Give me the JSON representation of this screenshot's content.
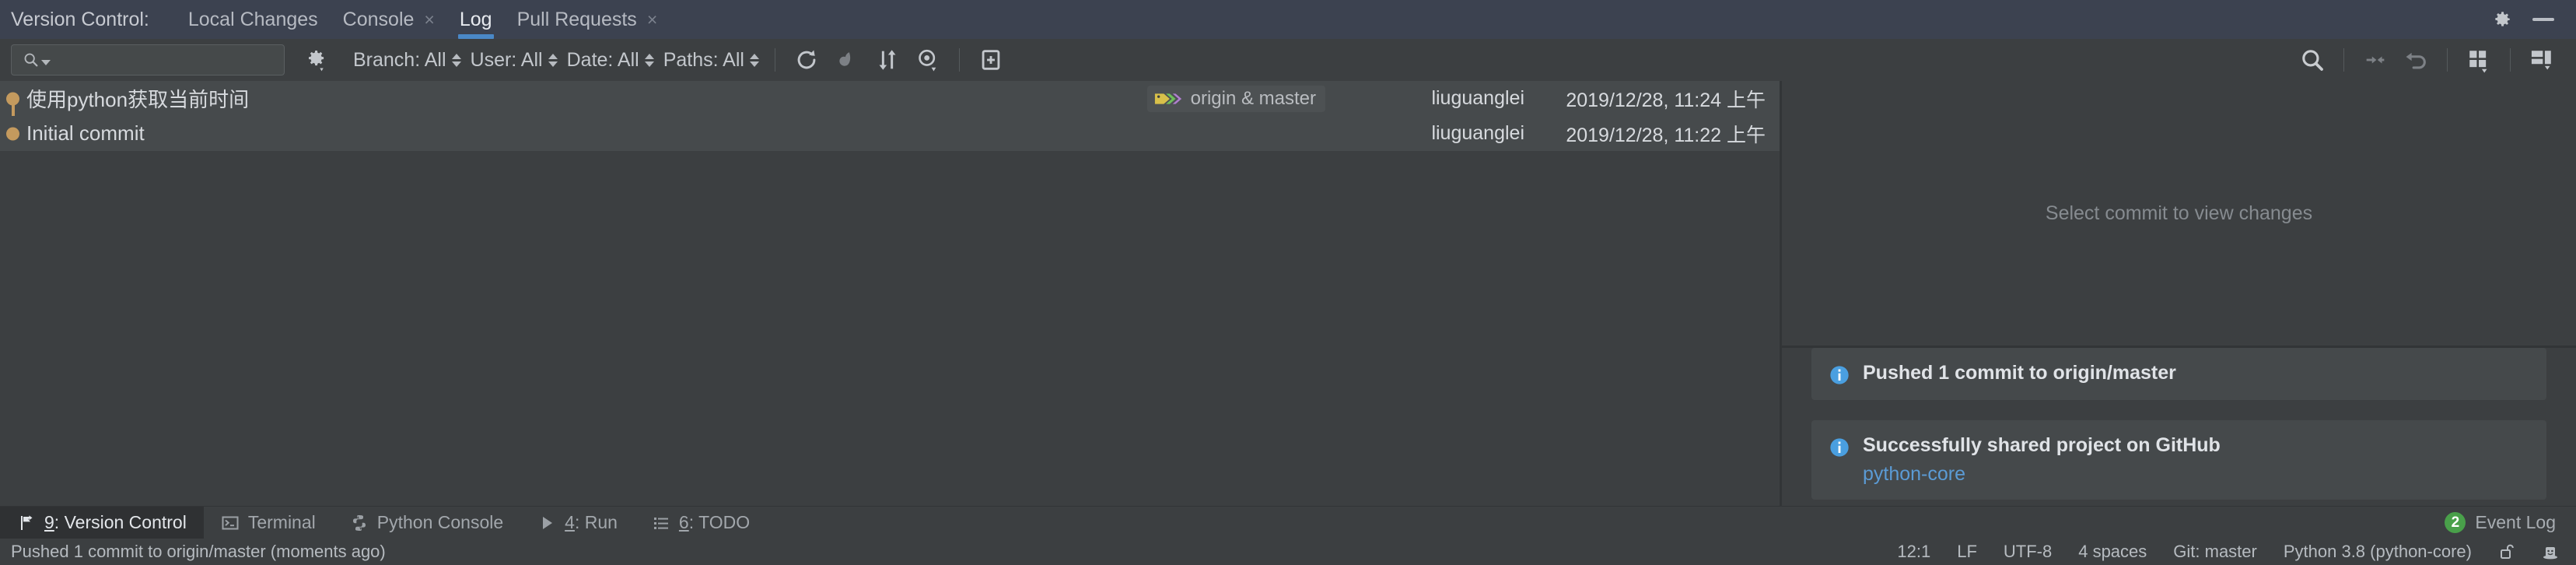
{
  "titlebar": {
    "label": "Version Control:",
    "tabs": [
      {
        "label": "Local Changes",
        "active": false,
        "closable": false
      },
      {
        "label": "Console",
        "active": false,
        "closable": true
      },
      {
        "label": "Log",
        "active": true,
        "closable": false
      },
      {
        "label": "Pull Requests",
        "active": false,
        "closable": true
      }
    ],
    "close_glyph": "×",
    "settings_icon": "gear-icon",
    "minimize_icon": "minimize-icon",
    "accent_color": "#4a88c7"
  },
  "toolbar": {
    "search_value": "",
    "search_placeholder": "",
    "search_icon": "search-icon",
    "settings_icon": "gear-icon",
    "filters": [
      {
        "label": "Branch: All"
      },
      {
        "label": "User: All"
      },
      {
        "label": "Date: All"
      },
      {
        "label": "Paths: All"
      }
    ],
    "actions": [
      {
        "icon": "refresh-icon"
      },
      {
        "icon": "cherry-pick-icon"
      },
      {
        "icon": "sort-icon"
      },
      {
        "icon": "eye-icon"
      },
      {
        "icon": "new-branch-icon"
      }
    ],
    "right_actions": [
      {
        "icon": "search-icon"
      },
      {
        "icon": "collapse-to-left-icon"
      },
      {
        "icon": "revert-icon"
      },
      {
        "icon": "grid-layout-icon"
      },
      {
        "icon": "split-layout-icon"
      }
    ],
    "far_right_actions": [
      {
        "icon": "expand-all-icon"
      },
      {
        "icon": "collapse-all-icon"
      }
    ]
  },
  "commits": {
    "rows": [
      {
        "subject": "使用python获取当前时间",
        "ref_label": "origin & master",
        "ref_icon": "branch-tag-icon",
        "author": "liuguanglei",
        "date": "2019/12/28, 11:24 上午"
      },
      {
        "subject": "Initial commit",
        "ref_label": "",
        "ref_icon": "",
        "author": "liuguanglei",
        "date": "2019/12/28, 11:22 上午"
      }
    ],
    "node_color": "#c49a5e"
  },
  "details": {
    "placeholder": "Select commit to view changes"
  },
  "notifications": [
    {
      "icon": "info-icon",
      "title": "Pushed 1 commit to origin/master",
      "link": ""
    },
    {
      "icon": "info-icon",
      "title": "Successfully shared project on GitHub",
      "link": "python-core"
    }
  ],
  "toolwindows": {
    "buttons": [
      {
        "mnemonic": "9",
        "label": ": Version Control",
        "icon": "version-control-icon",
        "active": true
      },
      {
        "mnemonic": "",
        "label": "Terminal",
        "icon": "terminal-icon",
        "active": false
      },
      {
        "mnemonic": "",
        "label": "Python Console",
        "icon": "python-icon",
        "active": false
      },
      {
        "mnemonic": "4",
        "label": ": Run",
        "icon": "run-icon",
        "active": false
      },
      {
        "mnemonic": "6",
        "label": ": TODO",
        "icon": "todo-icon",
        "active": false
      }
    ],
    "event_log": {
      "count": "2",
      "label": "Event Log",
      "badge_color": "#49a04a"
    }
  },
  "statusbar": {
    "message": "Pushed 1 commit to origin/master (moments ago)",
    "items": [
      {
        "label": "12:1"
      },
      {
        "label": "LF"
      },
      {
        "label": "UTF-8"
      },
      {
        "label": "4 spaces"
      },
      {
        "label": "Git: master"
      },
      {
        "label": "Python 3.8 (python-core)"
      }
    ],
    "lock_icon": "unlocked-padlock-icon",
    "inspector_icon": "inspector-hat-icon"
  }
}
